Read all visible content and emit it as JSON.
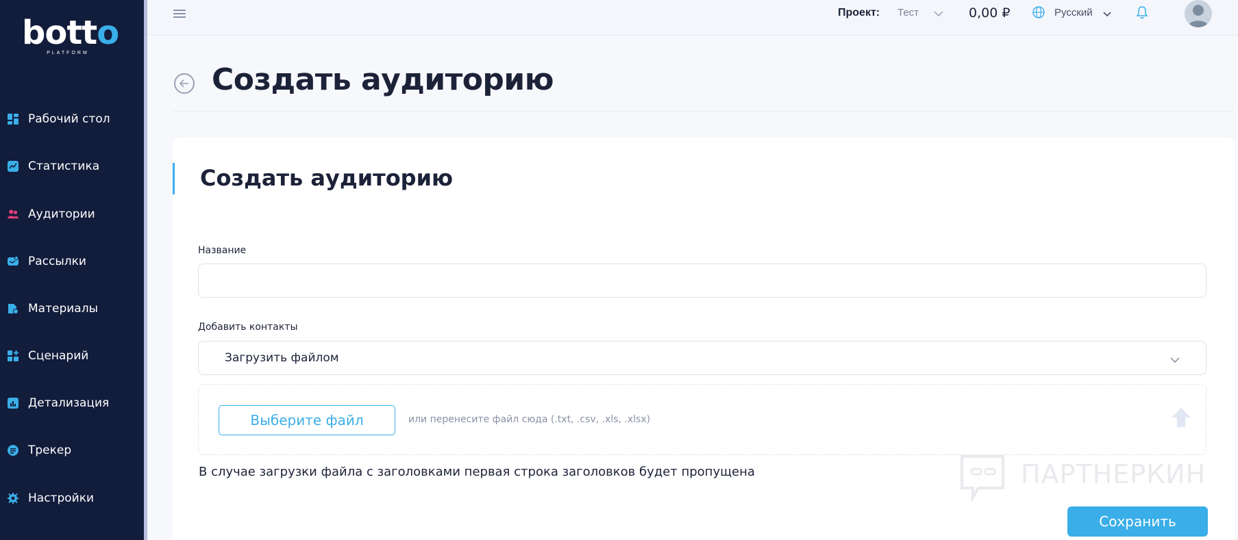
{
  "brand": {
    "logo_text_white_1": "bo",
    "logo_text_white_2": "tt",
    "logo_text_accent": "o",
    "logo_sub": "PLATFORM"
  },
  "sidebar": {
    "items": [
      {
        "label": "Рабочий стол",
        "icon": "dashboard-icon",
        "icon_color": "#3aaee8"
      },
      {
        "label": "Статистика",
        "icon": "chart-icon",
        "icon_color": "#3aaee8"
      },
      {
        "label": "Аудитории",
        "icon": "audience-icon",
        "icon_color": "#e0407a"
      },
      {
        "label": "Рассылки",
        "icon": "mailing-icon",
        "icon_color": "#3aaee8"
      },
      {
        "label": "Материалы",
        "icon": "materials-icon",
        "icon_color": "#3aaee8"
      },
      {
        "label": "Сценарий",
        "icon": "scenario-icon",
        "icon_color": "#3aaee8"
      },
      {
        "label": "Детализация",
        "icon": "details-icon",
        "icon_color": "#3aaee8"
      },
      {
        "label": "Трекер",
        "icon": "tracker-icon",
        "icon_color": "#3aaee8"
      },
      {
        "label": "Настройки",
        "icon": "settings-icon",
        "icon_color": "#3aaee8"
      }
    ]
  },
  "topbar": {
    "project_label": "Проект:",
    "project_value": "Тест",
    "balance": "0,00 ₽",
    "language": "Русский"
  },
  "page": {
    "title": "Создать аудиторию"
  },
  "card": {
    "title": "Создать аудиторию",
    "name_label": "Название",
    "name_value": "",
    "contacts_label": "Добавить контакты",
    "contacts_select_value": "Загрузить файлом",
    "choose_file_label": "Выберите файл",
    "drop_hint": "или перенесите файл сюда (.txt, .csv, .xls, .xlsx)",
    "note": "В случае загрузки файла с заголовками первая строка заголовков будет пропущена",
    "save_label": "Сохранить"
  },
  "watermark": {
    "text": "ПАРТНЕРКИН"
  },
  "colors": {
    "accent": "#3aaee8",
    "sidebar_bg": "#121c3b",
    "audience_accent": "#e0407a"
  }
}
